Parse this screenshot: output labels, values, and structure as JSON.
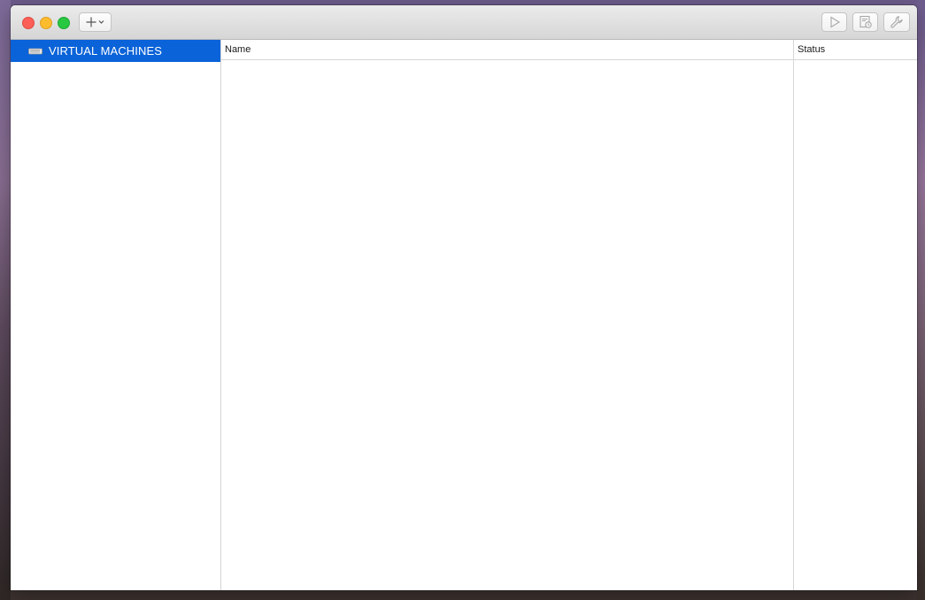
{
  "toolbar": {
    "add_icon": "plus-icon",
    "add_menu_icon": "chevron-down-icon",
    "start_icon": "play-icon",
    "snapshot_icon": "snapshot-icon",
    "settings_icon": "wrench-icon"
  },
  "sidebar": {
    "items": [
      {
        "label": "VIRTUAL MACHINES",
        "icon": "vm-drive-icon",
        "selected": true
      }
    ]
  },
  "table": {
    "columns": [
      "Name",
      "Status"
    ],
    "rows": []
  },
  "colors": {
    "selection": "#0a63d8",
    "close": "#fc5f57",
    "minimize": "#fdbc2e",
    "zoom": "#28c840"
  }
}
